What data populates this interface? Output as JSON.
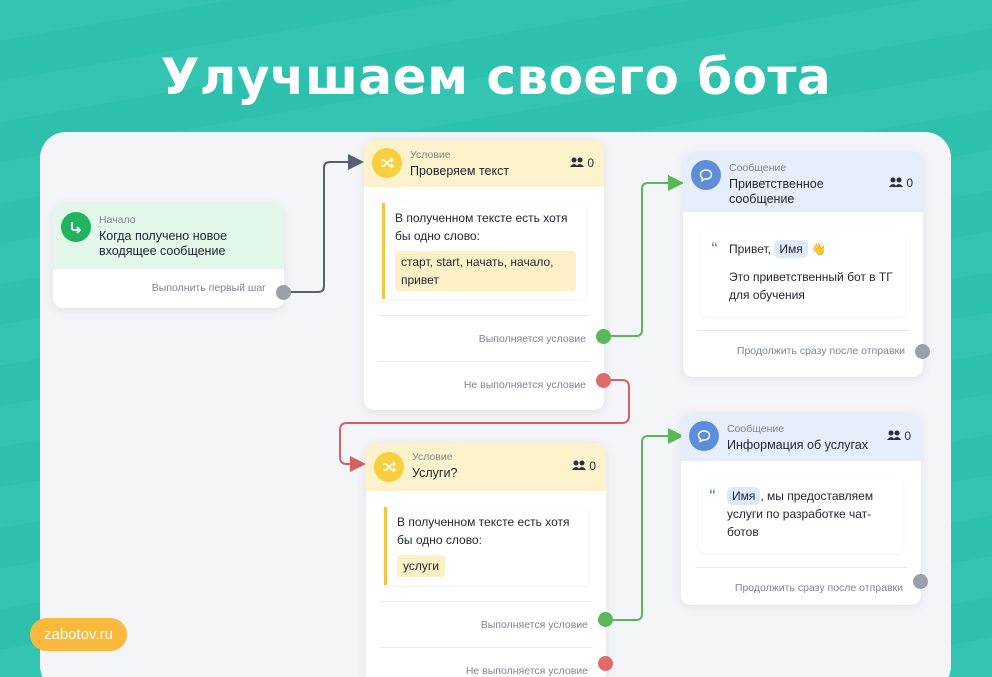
{
  "headline": "Улучшаем своего бота",
  "brand": "zabotov.ru",
  "nodes": {
    "start": {
      "type": "Начало",
      "title": "Когда получено новое входящее сообщение",
      "footer": "Выполнить первый шаг",
      "icon": "arrow-turn-icon"
    },
    "cond1": {
      "type": "Условие",
      "title": "Проверяем текст",
      "count": "0",
      "text": "В полученном тексте есть хотя бы одно слово:",
      "keywords": "старт, start, начать, начало, привет",
      "yes": "Выполняется условие",
      "no": "Не выполняется условие",
      "icon": "shuffle-icon"
    },
    "msg1": {
      "type": "Сообщение",
      "title": "Приветственное сообщение",
      "count": "0",
      "line1_pre": "Привет, ",
      "chip": "Имя",
      "emoji": "👋",
      "line2": "Это приветственный бот в ТГ для обучения",
      "footer": "Продолжить сразу после отправки",
      "icon": "chat-bubble-icon"
    },
    "cond2": {
      "type": "Условие",
      "title": "Услуги?",
      "count": "0",
      "text": "В полученном тексте есть хотя бы одно слово:",
      "keywords": "услуги",
      "yes": "Выполняется условие",
      "no": "Не выполняется условие",
      "icon": "shuffle-icon"
    },
    "msg2": {
      "type": "Сообщение",
      "title": "Информация об услугах",
      "count": "0",
      "chip": "Имя",
      "text": ", мы предоставляем услуги по разработке чат-ботов",
      "footer": "Продолжить сразу после отправки",
      "icon": "chat-bubble-icon"
    }
  },
  "colors": {
    "background": "#2ec4b0",
    "start_accent": "#23b35e",
    "condition_accent": "#f7cf3f",
    "message_accent": "#5c8fd7",
    "yes_link": "#5bb85a",
    "no_link": "#e06b6b",
    "brand_badge": "#f8b93c"
  }
}
